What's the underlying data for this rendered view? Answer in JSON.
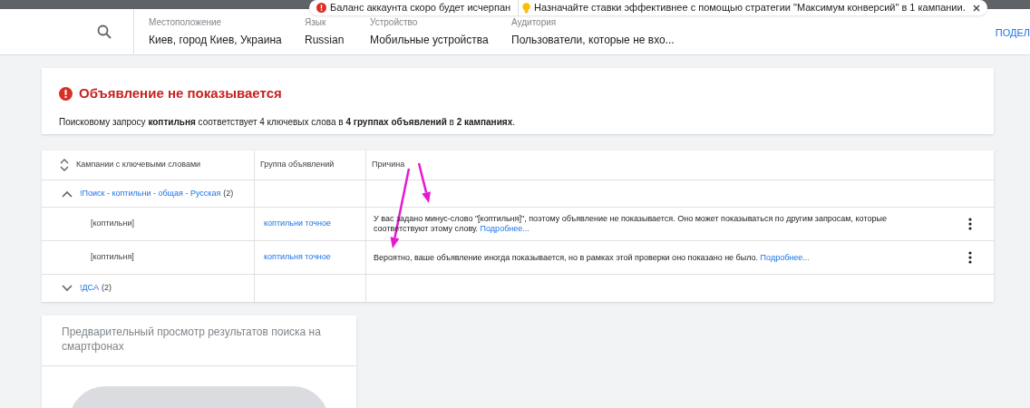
{
  "notifications": [
    {
      "kind": "error",
      "text": "Баланс аккаунта скоро будет исчерпан"
    },
    {
      "kind": "tip",
      "text": "Назначайте ставки эффективнее с помощью стратегии \"Максимум конверсий\" в 1 кампании."
    }
  ],
  "header": {
    "fields": [
      {
        "label": "Местоположение",
        "value": "Киев, город Киев, Украина"
      },
      {
        "label": "Язык",
        "value": "Russian"
      },
      {
        "label": "Устройство",
        "value": "Мобильные устройства"
      },
      {
        "label": "Аудитория",
        "value": "Пользователи, которые не вхо..."
      }
    ],
    "action": "ПОДЕЛ"
  },
  "alert": {
    "title": "Объявление не показывается",
    "message": "Поисковому запросу **коптильня** соответствует 4 ключевых слова в **4 группах объявлений** в **2 кампаниях**."
  },
  "table": {
    "columns": [
      "Кампании с ключевыми словами",
      "Группа объявлений",
      "Причина"
    ],
    "rows": [
      {
        "kind": "campaign",
        "name": "!Поиск - коптильни - общая - Русская",
        "count": "(2)",
        "expanded": true
      },
      {
        "kind": "keyword",
        "keyword": "[коптильни]",
        "ad_group": "коптильни точное",
        "reason": "У вас задано минус-слово \"[коптильня]\", поэтому объявление не показывается. Оно может показываться по другим запросам, которые соответствуют этому слову.",
        "link": "Подробнее..."
      },
      {
        "kind": "keyword",
        "keyword": "[коптильня]",
        "ad_group": "коптильня точное",
        "reason": "Вероятно, ваше объявление иногда показывается, но в рамках этой проверки оно показано не было.",
        "link": "Подробнее..."
      },
      {
        "kind": "campaign",
        "name": "!ДСА",
        "count": "(2)",
        "expanded": false
      }
    ]
  },
  "preview": {
    "title": "Предварительный просмотр результатов поиска на смартфонах"
  }
}
